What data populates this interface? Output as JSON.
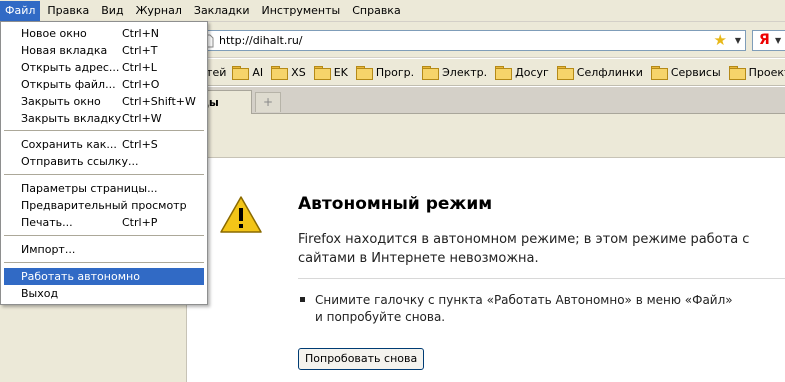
{
  "menubar": {
    "items": [
      "Файл",
      "Правка",
      "Вид",
      "Журнал",
      "Закладки",
      "Инструменты",
      "Справка"
    ]
  },
  "navbar": {
    "url": "http://dihalt.ru/",
    "search_engine": "Я"
  },
  "bookmarks": {
    "items": [
      "стей",
      "AI",
      "XS",
      "EK",
      "Прогр.",
      "Электр.",
      "Досуг",
      "Селфлинки",
      "Сервисы",
      "Проекты"
    ]
  },
  "tabs": {
    "active_label": "ицы",
    "new_tab_symbol": "+"
  },
  "file_menu": {
    "items": [
      {
        "label": "Новое окно",
        "shortcut": "Ctrl+N"
      },
      {
        "label": "Новая вкладка",
        "shortcut": "Ctrl+T"
      },
      {
        "label": "Открыть адрес...",
        "shortcut": "Ctrl+L"
      },
      {
        "label": "Открыть файл...",
        "shortcut": "Ctrl+O"
      },
      {
        "label": "Закрыть окно",
        "shortcut": "Ctrl+Shift+W"
      },
      {
        "label": "Закрыть вкладку",
        "shortcut": "Ctrl+W"
      },
      {
        "label": "Сохранить как...",
        "shortcut": "Ctrl+S"
      },
      {
        "label": "Отправить ссылку...",
        "shortcut": ""
      },
      {
        "label": "Параметры страницы...",
        "shortcut": ""
      },
      {
        "label": "Предварительный просмотр",
        "shortcut": ""
      },
      {
        "label": "Печать...",
        "shortcut": "Ctrl+P"
      },
      {
        "label": "Импорт...",
        "shortcut": ""
      },
      {
        "label": "Работать автономно",
        "shortcut": ""
      },
      {
        "label": "Выход",
        "shortcut": ""
      }
    ]
  },
  "error_page": {
    "title": "Автономный режим",
    "description": "Firefox находится в автономном режиме; в этом режиме работа с сайтами в Интернете невозможна.",
    "hint": "Снимите галочку с пункта «Работать Автономно» в меню «Файл» и попробуйте снова.",
    "retry_label": "Попробовать снова"
  },
  "colors": {
    "highlight": "#316ac5",
    "chrome": "#ece9d8",
    "warning": "#f3c518"
  }
}
